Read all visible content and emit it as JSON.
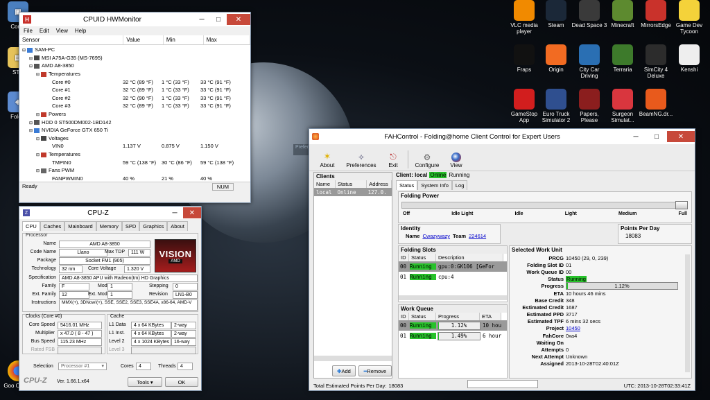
{
  "desktop": {
    "left_icons": [
      {
        "label": "Comp",
        "icon": "computer-icon"
      },
      {
        "label": "STU",
        "icon": "folder-icon"
      },
      {
        "label": "Foldin",
        "icon": "folding-icon"
      },
      {
        "label": "Goo Chrom",
        "icon": "chrome-icon"
      }
    ],
    "right_icons": [
      {
        "label": "VLC media player",
        "icon": "vlc-icon",
        "color": "#f18a00"
      },
      {
        "label": "Steam",
        "icon": "steam-icon",
        "color": "#1b2838"
      },
      {
        "label": "Dead Space 3",
        "icon": "deadspace-icon",
        "color": "#3a3a3a"
      },
      {
        "label": "Minecraft",
        "icon": "minecraft-icon",
        "color": "#5d8a2f"
      },
      {
        "label": "MirrorsEdge",
        "icon": "mirrorsedge-icon",
        "color": "#c9322b"
      },
      {
        "label": "Game Dev Tycoon",
        "icon": "gamedev-icon",
        "color": "#f4d23a"
      },
      {
        "label": "Fraps",
        "icon": "fraps-icon",
        "color": "#111111"
      },
      {
        "label": "Origin",
        "icon": "origin-icon",
        "color": "#f26b22"
      },
      {
        "label": "City Car Driving",
        "icon": "citycar-icon",
        "color": "#2a6fb3"
      },
      {
        "label": "Terraria",
        "icon": "terraria-icon",
        "color": "#3d7a2b"
      },
      {
        "label": "SimCity 4 Deluxe",
        "icon": "simcity-icon",
        "color": "#2c2c2c"
      },
      {
        "label": "Kenshi",
        "icon": "kenshi-icon",
        "color": "#eeeeee"
      },
      {
        "label": "GameStop App",
        "icon": "gamestop-icon",
        "color": "#d21e1e"
      },
      {
        "label": "Euro Truck Simulator 2",
        "icon": "eurotruck-icon",
        "color": "#2f4f8f"
      },
      {
        "label": "Papers, Please",
        "icon": "papers-icon",
        "color": "#8b1e1e"
      },
      {
        "label": "Surgeon Simulat...",
        "icon": "surgeon-icon",
        "color": "#d9363e"
      },
      {
        "label": "BeamNG.dr...",
        "icon": "beamng-icon",
        "color": "#e85a1c"
      }
    ]
  },
  "hwmonitor": {
    "title": "CPUID HWMonitor",
    "menu": [
      "File",
      "Edit",
      "View",
      "Help"
    ],
    "columns": [
      "Sensor",
      "Value",
      "Min",
      "Max"
    ],
    "rows": [
      {
        "indent": 0,
        "sensor": "SAM-PC",
        "value": "",
        "min": "",
        "max": ""
      },
      {
        "indent": 1,
        "sensor": "MSI A75A-G35 (MS-7695)",
        "value": "",
        "min": "",
        "max": ""
      },
      {
        "indent": 1,
        "sensor": "AMD A8-3850",
        "value": "",
        "min": "",
        "max": ""
      },
      {
        "indent": 2,
        "sensor": "Temperatures",
        "value": "",
        "min": "",
        "max": ""
      },
      {
        "indent": 3,
        "sensor": "Core #0",
        "value": "32 °C (89 °F)",
        "min": "1 °C (33 °F)",
        "max": "33 °C (91 °F)"
      },
      {
        "indent": 3,
        "sensor": "Core #1",
        "value": "32 °C (89 °F)",
        "min": "1 °C (33 °F)",
        "max": "33 °C (91 °F)"
      },
      {
        "indent": 3,
        "sensor": "Core #2",
        "value": "32 °C (90 °F)",
        "min": "1 °C (33 °F)",
        "max": "33 °C (91 °F)"
      },
      {
        "indent": 3,
        "sensor": "Core #3",
        "value": "32 °C (89 °F)",
        "min": "1 °C (33 °F)",
        "max": "33 °C (91 °F)"
      },
      {
        "indent": 2,
        "sensor": "Powers",
        "value": "",
        "min": "",
        "max": ""
      },
      {
        "indent": 1,
        "sensor": "HDD 0 ST500DM002-1BD142",
        "value": "",
        "min": "",
        "max": ""
      },
      {
        "indent": 1,
        "sensor": "NVIDIA GeForce GTX 650 Ti",
        "value": "",
        "min": "",
        "max": ""
      },
      {
        "indent": 2,
        "sensor": "Voltages",
        "value": "",
        "min": "",
        "max": ""
      },
      {
        "indent": 3,
        "sensor": "VIN0",
        "value": "1.137 V",
        "min": "0.875 V",
        "max": "1.150 V"
      },
      {
        "indent": 2,
        "sensor": "Temperatures",
        "value": "",
        "min": "",
        "max": ""
      },
      {
        "indent": 3,
        "sensor": "TMPIN0",
        "value": "59 °C (138 °F)",
        "min": "30 °C (86 °F)",
        "max": "59 °C (138 °F)"
      },
      {
        "indent": 2,
        "sensor": "Fans PWM",
        "value": "",
        "min": "",
        "max": ""
      },
      {
        "indent": 3,
        "sensor": "FANPWMIN0",
        "value": "40 %",
        "min": "21 %",
        "max": "40 %"
      }
    ],
    "status": "Ready",
    "num": "NUM"
  },
  "cpuz": {
    "title": "CPU-Z",
    "tabs": [
      "CPU",
      "Caches",
      "Mainboard",
      "Memory",
      "SPD",
      "Graphics",
      "About"
    ],
    "processor_label": "Processor",
    "name_label": "Name",
    "name": "AMD A8-3850",
    "codename_label": "Code Name",
    "codename": "Llano",
    "maxtdp_label": "Max TDP",
    "maxtdp": "111 W",
    "package_label": "Package",
    "package": "Socket FM1 (905)",
    "technology_label": "Technology",
    "technology": "32 nm",
    "corevoltage_label": "Core Voltage",
    "corevoltage": "1.320 V",
    "spec_label": "Specification",
    "spec": "AMD A8-3850 APU with Radeon(tm) HD Graphics",
    "family_label": "Family",
    "family": "F",
    "model_label": "Model",
    "model": "1",
    "stepping_label": "Stepping",
    "stepping": "0",
    "extfamily_label": "Ext. Family",
    "extfamily": "12",
    "extmodel_label": "Ext. Model",
    "extmodel": "1",
    "revision_label": "Revision",
    "revision": "LN1-B0",
    "instructions_label": "Instructions",
    "instructions": "MMX(+), 3DNow!(+), SSE, SSE2, SSE3, SSE4A, x86-64, AMD-V",
    "logo_text": "VISION",
    "logo_sub": "AMD",
    "clocks_label": "Clocks (Core #0)",
    "corespeed_label": "Core Speed",
    "corespeed": "5416.01 MHz",
    "multiplier_label": "Multiplier",
    "multiplier": "x 47.0 ( 8 - 47 )",
    "busspeed_label": "Bus Speed",
    "busspeed": "115.23 MHz",
    "ratedfsb_label": "Rated FSB",
    "ratedfsb": "",
    "cache_label": "Cache",
    "l1data_label": "L1 Data",
    "l1data": "4 x 64 KBytes",
    "l1data_way": "2-way",
    "l1inst_label": "L1 Inst.",
    "l1inst": "4 x 64 KBytes",
    "l1inst_way": "2-way",
    "level2_label": "Level 2",
    "level2": "4 x 1024 KBytes",
    "level2_way": "16-way",
    "level3_label": "Level 3",
    "level3": "",
    "selection_label": "Selection",
    "selection": "Processor #1",
    "cores_label": "Cores",
    "cores": "4",
    "threads_label": "Threads",
    "threads": "4",
    "brand": "CPU-Z",
    "version": "Ver. 1.66.1.x64",
    "tools_label": "Tools",
    "ok_label": "OK"
  },
  "fah": {
    "title": "FAHControl - Folding@home Client Control for Expert Users",
    "toolbar": [
      "About",
      "Preferences",
      "Exit",
      "Configure",
      "View"
    ],
    "ghost_text": "Preferences",
    "clients_label": "Clients",
    "clients_columns": [
      "Name",
      "Status",
      "Address"
    ],
    "clients_row": {
      "name": "local",
      "status": "Online",
      "address": "127.0."
    },
    "client_header_prefix": "Client: local",
    "client_online": "Online",
    "client_running": "Running",
    "tabs": [
      "Status",
      "System Info",
      "Log"
    ],
    "folding_power_label": "Folding Power",
    "power_levels": [
      "Off",
      "Idle Light",
      "Idle",
      "Light",
      "Medium",
      "Full"
    ],
    "power_level": 1.0,
    "identity_label": "Identity",
    "name_label": "Name",
    "name": "Cwazywazy",
    "team_label": "Team",
    "team": "224614",
    "ppd_label": "Points Per Day",
    "ppd": "18083",
    "slots_label": "Folding Slots",
    "slots_columns": [
      "ID",
      "Status",
      "Description"
    ],
    "slots": [
      {
        "id": "00",
        "status": "Running",
        "desc": "gpu:0:GK106 [GeFor"
      },
      {
        "id": "01",
        "status": "Running",
        "desc": "cpu:4"
      }
    ],
    "queue_label": "Work Queue",
    "queue_columns": [
      "ID",
      "Status",
      "Progress",
      "ETA"
    ],
    "queue": [
      {
        "id": "00",
        "status": "Running",
        "progress": "1.12%",
        "progress_value": 0.0112,
        "eta": "10 hou"
      },
      {
        "id": "01",
        "status": "Running",
        "progress": "1.49%",
        "progress_value": 0.0149,
        "eta": "6 hour"
      }
    ],
    "add_label": "Add",
    "remove_label": "Remove",
    "swu_label": "Selected Work Unit",
    "swu": [
      {
        "k": "PRCG",
        "v": "10450 (29, 0, 239)"
      },
      {
        "k": "Folding Slot ID",
        "v": "01"
      },
      {
        "k": "Work Queue ID",
        "v": "00"
      },
      {
        "k": "Status",
        "v": "Running"
      },
      {
        "k": "Progress",
        "v": "1.12%"
      },
      {
        "k": "ETA",
        "v": "10 hours 46 mins"
      },
      {
        "k": "Base Credit",
        "v": "348"
      },
      {
        "k": "Estimated Credit",
        "v": "1687"
      },
      {
        "k": "Estimated PPD",
        "v": "3717"
      },
      {
        "k": "Estimated TPF",
        "v": "6 mins 32 secs"
      },
      {
        "k": "Project",
        "v": "10450"
      },
      {
        "k": "FahCore",
        "v": "0xa4"
      },
      {
        "k": "Waiting On",
        "v": ""
      },
      {
        "k": "Attempts",
        "v": "0"
      },
      {
        "k": "Next Attempt",
        "v": "Unknown"
      },
      {
        "k": "Assigned",
        "v": "2013-10-28T02:40:01Z"
      }
    ],
    "swu_progress_value": 0.0112,
    "footer_total_label": "Total Estimated Points Per Day:",
    "footer_total": "18083",
    "footer_utc": "UTC: 2013-10-28T02:33:41Z"
  }
}
